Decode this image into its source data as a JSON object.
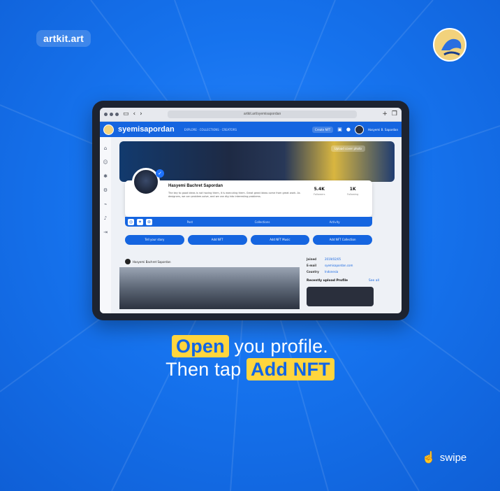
{
  "brand": {
    "label": "artkit.art"
  },
  "colors": {
    "background": "#1673ee",
    "accent": "#1565e0",
    "highlight": "#ffd53d"
  },
  "browser": {
    "url": "artkit.art/syemisapordan"
  },
  "app": {
    "name": "syemisapordan",
    "nav": "EXPLORE  ·  COLLECTIONS  ·  CREATORS",
    "primary_button": "Create NFT",
    "user_name": "Hasyemi B. Sapordan"
  },
  "sidebar": {
    "icons": [
      "home-icon",
      "user-icon",
      "grid-icon",
      "settings-icon",
      "chart-icon",
      "bell-icon",
      "logout-icon"
    ]
  },
  "cover": {
    "button": "Upload cover photo"
  },
  "profile": {
    "name": "Hasyemi Bachret Sapordan",
    "bio": "The key to good ideas is not having them, it is executing them. Great great ideas come from great work. As designers, we can problem-solve, and we can dig into interesting problems.",
    "stats": [
      {
        "value": "5.4K",
        "label": "Followers"
      },
      {
        "value": "1K",
        "label": "Following"
      }
    ]
  },
  "tabs": [
    "Post",
    "Collections",
    "Activity"
  ],
  "actions": [
    "Tell your story",
    "Add NFT",
    "Add NFT Music",
    "Add NFT Collection"
  ],
  "post": {
    "author": "Hasyemi Bachret Sapordan"
  },
  "info": {
    "rows": [
      {
        "key": "Joined",
        "value": "2019/02/05"
      },
      {
        "key": "E-mail",
        "value": "syemisapordan.com"
      },
      {
        "key": "Country",
        "value": "Indonesia"
      }
    ],
    "recent_title": "Recently upload Profile",
    "recent_link": "See all"
  },
  "headline": {
    "line1_highlight": "Open",
    "line1_rest": " you profile.",
    "line2_prefix": "Then tap ",
    "line2_highlight": "Add NFT"
  },
  "swipe": {
    "label": "swipe"
  }
}
